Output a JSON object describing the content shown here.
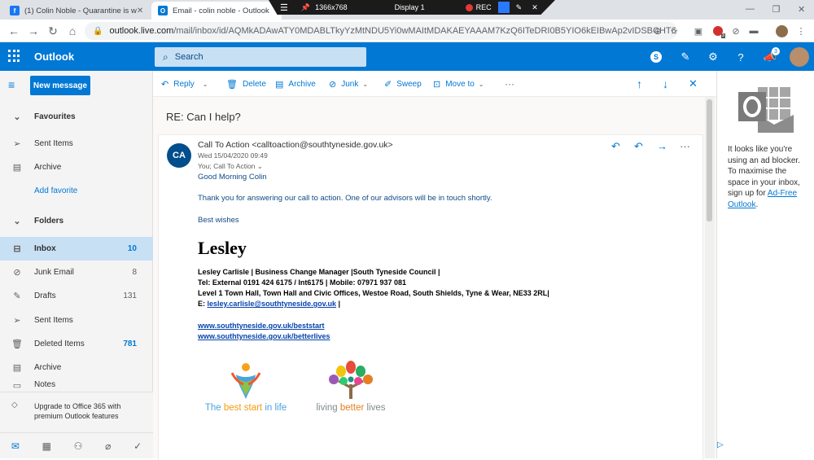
{
  "browser": {
    "tabs": [
      {
        "title": "(1) Colin Noble - Quarantine is w",
        "icon": "facebook-icon",
        "color": "#1877f2"
      },
      {
        "title": "Email - colin noble - Outlook",
        "icon": "outlook-icon",
        "color": "#0078d4"
      }
    ],
    "recorder": {
      "resolution": "1366x768",
      "display": "Display 1",
      "rec_label": "REC"
    },
    "url_main": "outlook.live.com",
    "url_rest": "/mail/inbox/id/AQMkADAwATY0MDABLTkyYzMtNDU5Yi0wMAItMDAKAEYAAAM7KzQ6ITeDRI0B5YIO6kEIBwAp2vIDSBCHT6BDXk...",
    "extension_badge": "3"
  },
  "outlook": {
    "brand": "Outlook",
    "search_placeholder": "Search",
    "notif_badge": "3",
    "accent": "#0078d4"
  },
  "nav": {
    "new_message": "New message",
    "favourites": "Favourites",
    "fav_items": [
      {
        "label": "Sent Items",
        "icon": "send-icon"
      },
      {
        "label": "Archive",
        "icon": "archive-icon"
      }
    ],
    "add_favorite": "Add favorite",
    "folders": "Folders",
    "folder_items": [
      {
        "label": "Inbox",
        "count": "10",
        "icon": "inbox-icon"
      },
      {
        "label": "Junk Email",
        "count": "8",
        "icon": "junk-icon"
      },
      {
        "label": "Drafts",
        "count": "131",
        "icon": "pencil-icon"
      },
      {
        "label": "Sent Items",
        "count": "",
        "icon": "send-icon"
      },
      {
        "label": "Deleted Items",
        "count": "781",
        "icon": "trash-icon"
      },
      {
        "label": "Archive",
        "count": "",
        "icon": "archive-icon"
      },
      {
        "label": "Notes",
        "count": "",
        "icon": "notes-icon"
      }
    ],
    "upgrade_line1": "Upgrade to Office 365 with",
    "upgrade_line2": "premium Outlook features"
  },
  "toolbar": {
    "reply": "Reply",
    "delete": "Delete",
    "archive": "Archive",
    "junk": "Junk",
    "sweep": "Sweep",
    "move_to": "Move to",
    "more": "···"
  },
  "message": {
    "subject": "RE: Can I help?",
    "avatar_initials": "CA",
    "sender": "Call To Action <calltoaction@southtyneside.gov.uk>",
    "date": "Wed 15/04/2020 09:49",
    "to": "You; Call To Action",
    "greeting": "Good Morning Colin",
    "para1": "Thank you for answering our call to action.  One of our advisors will be in touch shortly.",
    "closing": "Best wishes",
    "sig_name": "Lesley",
    "sig_line1": "Lesley Carlisle | Business Change Manager |South Tyneside Council |",
    "sig_line2": "Tel: External 0191 424 6175 / Int6175 | Mobile: 07971 937 081",
    "sig_line3": "Level 1 Town Hall, Town Hall and Civic Offices, Westoe Road, South Shields, Tyne & Wear, NE33 2RL|",
    "sig_email_prefix": "E: ",
    "sig_email": "lesley.carlisle@southtyneside.gov.uk",
    "sig_email_suffix": " |",
    "link1": "www.southtyneside.gov.uk/beststart",
    "link2": "www.southtyneside.gov.uk/betterlives",
    "logo1_text_a": "The ",
    "logo1_text_b": "best start",
    "logo1_text_c": " in life",
    "logo2_text_a": "living ",
    "logo2_text_b": "better",
    "logo2_text_c": " lives"
  },
  "ad": {
    "text": "It looks like you're using an ad blocker. To maximise the space in your inbox, sign up for ",
    "link": "Ad-Free Outlook",
    "end": "."
  }
}
